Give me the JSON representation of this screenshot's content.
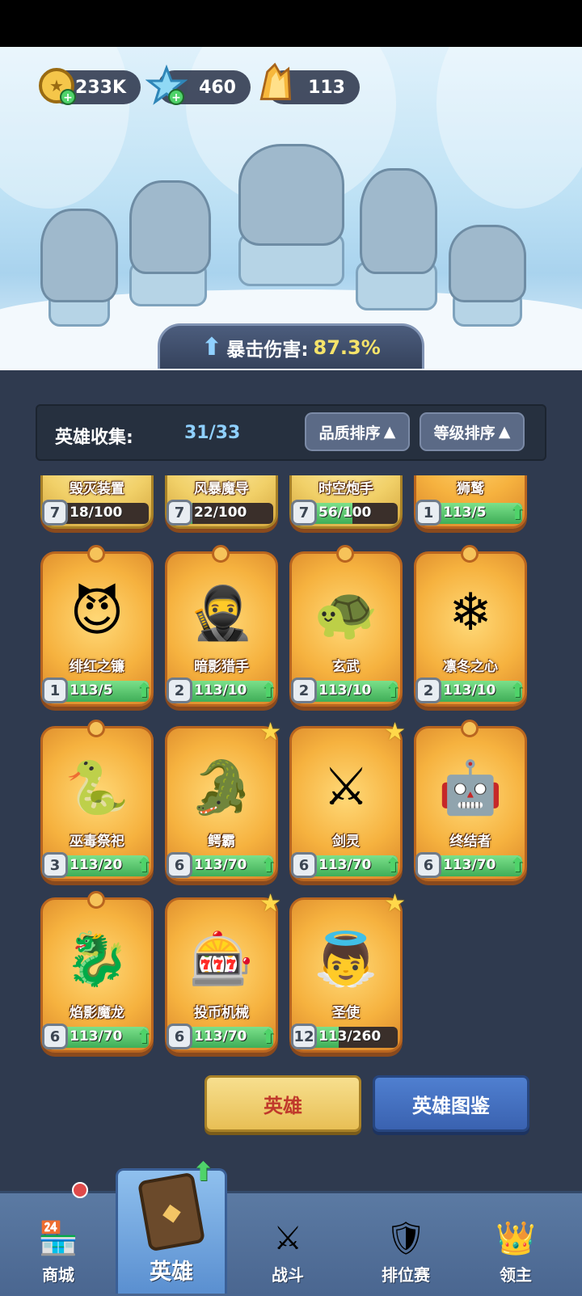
{
  "resources": {
    "gold": "233K",
    "crystal": "460",
    "shard": "113"
  },
  "crit": {
    "label": "暴击伤害:",
    "value": "87.3%"
  },
  "collection": {
    "label": "英雄收集:",
    "value": "31/33",
    "sort_quality": "品质排序",
    "sort_level": "等级排序"
  },
  "heroes": [
    {
      "name": "毁灭装置",
      "level": "7",
      "progress": "18/100",
      "fill": 0.18,
      "upgradable": false,
      "starred": false,
      "gold": true
    },
    {
      "name": "风暴魔导",
      "level": "7",
      "progress": "22/100",
      "fill": 0.22,
      "upgradable": false,
      "starred": false,
      "gold": true
    },
    {
      "name": "时空炮手",
      "level": "7",
      "progress": "56/100",
      "fill": 0.56,
      "upgradable": false,
      "starred": false,
      "gold": true
    },
    {
      "name": "狮鹫",
      "level": "1",
      "progress": "113/5",
      "fill": 1.0,
      "upgradable": true,
      "starred": false,
      "gold": false
    },
    {
      "name": "绯红之镰",
      "level": "1",
      "progress": "113/5",
      "fill": 1.0,
      "upgradable": true,
      "starred": false,
      "gold": false
    },
    {
      "name": "暗影猎手",
      "level": "2",
      "progress": "113/10",
      "fill": 1.0,
      "upgradable": true,
      "starred": false,
      "gold": false
    },
    {
      "name": "玄武",
      "level": "2",
      "progress": "113/10",
      "fill": 1.0,
      "upgradable": true,
      "starred": false,
      "gold": false
    },
    {
      "name": "凛冬之心",
      "level": "2",
      "progress": "113/10",
      "fill": 1.0,
      "upgradable": true,
      "starred": false,
      "gold": false
    },
    {
      "name": "巫毒祭祀",
      "level": "3",
      "progress": "113/20",
      "fill": 1.0,
      "upgradable": true,
      "starred": false,
      "gold": false
    },
    {
      "name": "鳄霸",
      "level": "6",
      "progress": "113/70",
      "fill": 1.0,
      "upgradable": true,
      "starred": true,
      "gold": false
    },
    {
      "name": "剑灵",
      "level": "6",
      "progress": "113/70",
      "fill": 1.0,
      "upgradable": true,
      "starred": true,
      "gold": false
    },
    {
      "name": "终结者",
      "level": "6",
      "progress": "113/70",
      "fill": 1.0,
      "upgradable": true,
      "starred": false,
      "gold": false
    },
    {
      "name": "焰影魔龙",
      "level": "6",
      "progress": "113/70",
      "fill": 1.0,
      "upgradable": true,
      "starred": false,
      "gold": false
    },
    {
      "name": "投币机械",
      "level": "6",
      "progress": "113/70",
      "fill": 1.0,
      "upgradable": true,
      "starred": true,
      "gold": false
    },
    {
      "name": "圣使",
      "level": "12",
      "progress": "113/260",
      "fill": 0.43,
      "upgradable": false,
      "starred": true,
      "gold": false
    }
  ],
  "buttons": {
    "hero": "英雄",
    "codex": "英雄图鉴"
  },
  "nav": {
    "shop": "商城",
    "hero": "英雄",
    "battle": "战斗",
    "ranked": "排位赛",
    "lord": "领主"
  },
  "icons": {
    "gold": "gold-coin-icon",
    "crystal": "snowflake-crystal-icon",
    "shard": "amber-shard-icon"
  }
}
